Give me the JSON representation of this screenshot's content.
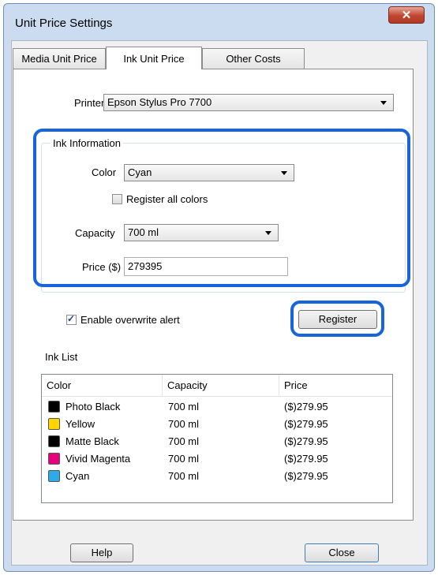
{
  "window": {
    "title": "Unit Price Settings",
    "close_glyph": "✕"
  },
  "tabs": [
    {
      "label": "Media Unit Price",
      "active": false
    },
    {
      "label": "Ink Unit Price",
      "active": true
    },
    {
      "label": "Other Costs",
      "active": false
    }
  ],
  "printer": {
    "label": "Printer",
    "value": "Epson Stylus Pro 7700"
  },
  "ink_info": {
    "title": "Ink Information",
    "color_label": "Color",
    "color_value": "Cyan",
    "register_all_label": "Register all colors",
    "register_all_checked": false,
    "capacity_label": "Capacity",
    "capacity_value": "700 ml",
    "price_label": "Price ($)",
    "price_value": "279395"
  },
  "overwrite_alert": {
    "label": "Enable overwrite alert",
    "checked": true
  },
  "register_button": "Register",
  "ink_list": {
    "title": "Ink List",
    "columns": [
      "Color",
      "Capacity",
      "Price"
    ],
    "rows": [
      {
        "color": "Photo Black",
        "swatch": "#000000",
        "capacity": "700 ml",
        "price": "($)279.95"
      },
      {
        "color": "Yellow",
        "swatch": "#ffd400",
        "capacity": "700 ml",
        "price": "($)279.95"
      },
      {
        "color": "Matte Black",
        "swatch": "#000000",
        "capacity": "700 ml",
        "price": "($)279.95"
      },
      {
        "color": "Vivid Magenta",
        "swatch": "#e6007e",
        "capacity": "700 ml",
        "price": "($)279.95"
      },
      {
        "color": "Cyan",
        "swatch": "#2ea9ea",
        "capacity": "700 ml",
        "price": "($)279.95"
      }
    ]
  },
  "buttons": {
    "help": "Help",
    "close": "Close"
  },
  "colors": {
    "highlight": "#1864dc",
    "window_frame": "#cbdcf0"
  }
}
